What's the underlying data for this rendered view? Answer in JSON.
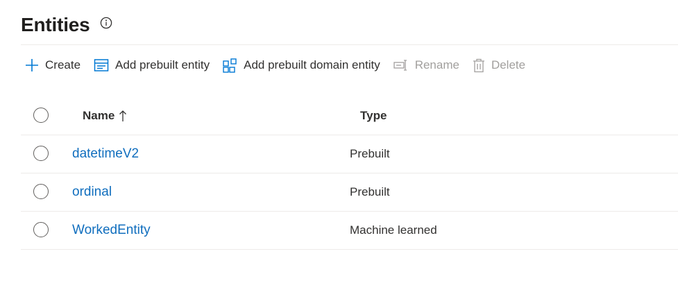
{
  "page": {
    "title": "Entities",
    "info_icon": "info-icon"
  },
  "toolbar": {
    "create_label": "Create",
    "add_prebuilt_label": "Add prebuilt entity",
    "add_prebuilt_domain_label": "Add prebuilt domain entity",
    "rename_label": "Rename",
    "delete_label": "Delete"
  },
  "table": {
    "columns": {
      "name": "Name",
      "type": "Type",
      "sort": "ascending"
    },
    "rows": [
      {
        "name": "datetimeV2",
        "type": "Prebuilt"
      },
      {
        "name": "ordinal",
        "type": "Prebuilt"
      },
      {
        "name": "WorkedEntity",
        "type": "Machine learned"
      }
    ]
  },
  "colors": {
    "accent": "#0078d4",
    "link": "#106ebe",
    "disabled": "#a19f9d",
    "divider": "#edebe9"
  }
}
